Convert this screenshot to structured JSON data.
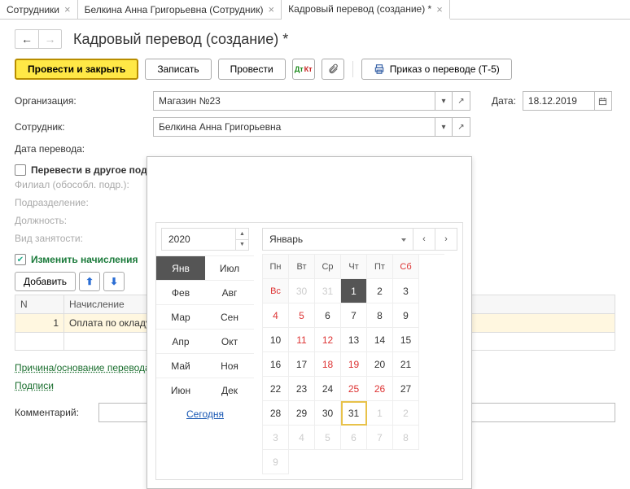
{
  "tabs": [
    {
      "label": "Сотрудники"
    },
    {
      "label": "Белкина Анна Григорьевна (Сотрудник)"
    },
    {
      "label": "Кадровый перевод (создание) *",
      "active": true
    }
  ],
  "title": "Кадровый перевод (создание) *",
  "toolbar": {
    "execute_close": "Провести и закрыть",
    "write": "Записать",
    "execute": "Провести",
    "order": "Приказ о переводе (Т-5)"
  },
  "form": {
    "org_label": "Организация:",
    "org_value": "Магазин №23",
    "date_label": "Дата:",
    "date_value": "18.12.2019",
    "emp_label": "Сотрудник:",
    "emp_value": "Белкина Анна Григорьевна",
    "transfer_date_label": "Дата перевода:",
    "transfer_other_dept": "Перевести в другое подразделение",
    "branch_label": "Филиал (обособл. подр.):",
    "dept_label": "Подразделение:",
    "position_label": "Должность:",
    "employment_label": "Вид занятости:",
    "change_accruals": "Изменить начисления",
    "add_btn": "Добавить",
    "tbl_n": "N",
    "tbl_accrual": "Начисление",
    "row_n": "1",
    "row_accrual": "Оплата по окладу",
    "reason_link": "Причина/основание перевода",
    "signatures_link": "Подписи",
    "comment_label": "Комментарий:"
  },
  "calendar": {
    "year": "2020",
    "months": [
      "Янв",
      "Июл",
      "Фев",
      "Авг",
      "Мар",
      "Сен",
      "Апр",
      "Окт",
      "Май",
      "Ноя",
      "Июн",
      "Дек"
    ],
    "today": "Сегодня",
    "month_name": "Январь",
    "weekdays": [
      "Пн",
      "Вт",
      "Ср",
      "Чт",
      "Пт",
      "Сб",
      "Вс"
    ],
    "days": [
      {
        "d": "30",
        "cls": "other"
      },
      {
        "d": "31",
        "cls": "other"
      },
      {
        "d": "1",
        "cls": "selected"
      },
      {
        "d": "2"
      },
      {
        "d": "3"
      },
      {
        "d": "4",
        "cls": "weekend"
      },
      {
        "d": "5",
        "cls": "weekend"
      },
      {
        "d": "6"
      },
      {
        "d": "7"
      },
      {
        "d": "8"
      },
      {
        "d": "9"
      },
      {
        "d": "10"
      },
      {
        "d": "11",
        "cls": "weekend"
      },
      {
        "d": "12",
        "cls": "weekend"
      },
      {
        "d": "13"
      },
      {
        "d": "14"
      },
      {
        "d": "15"
      },
      {
        "d": "16"
      },
      {
        "d": "17"
      },
      {
        "d": "18",
        "cls": "weekend"
      },
      {
        "d": "19",
        "cls": "weekend"
      },
      {
        "d": "20"
      },
      {
        "d": "21"
      },
      {
        "d": "22"
      },
      {
        "d": "23"
      },
      {
        "d": "24"
      },
      {
        "d": "25",
        "cls": "weekend"
      },
      {
        "d": "26",
        "cls": "weekend"
      },
      {
        "d": "27"
      },
      {
        "d": "28"
      },
      {
        "d": "29"
      },
      {
        "d": "30"
      },
      {
        "d": "31",
        "cls": "today"
      },
      {
        "d": "1",
        "cls": "other"
      },
      {
        "d": "2",
        "cls": "other"
      },
      {
        "d": "3",
        "cls": "other"
      },
      {
        "d": "4",
        "cls": "other"
      },
      {
        "d": "5",
        "cls": "other"
      },
      {
        "d": "6",
        "cls": "other"
      },
      {
        "d": "7",
        "cls": "other"
      },
      {
        "d": "8",
        "cls": "other"
      },
      {
        "d": "9",
        "cls": "other"
      }
    ]
  }
}
